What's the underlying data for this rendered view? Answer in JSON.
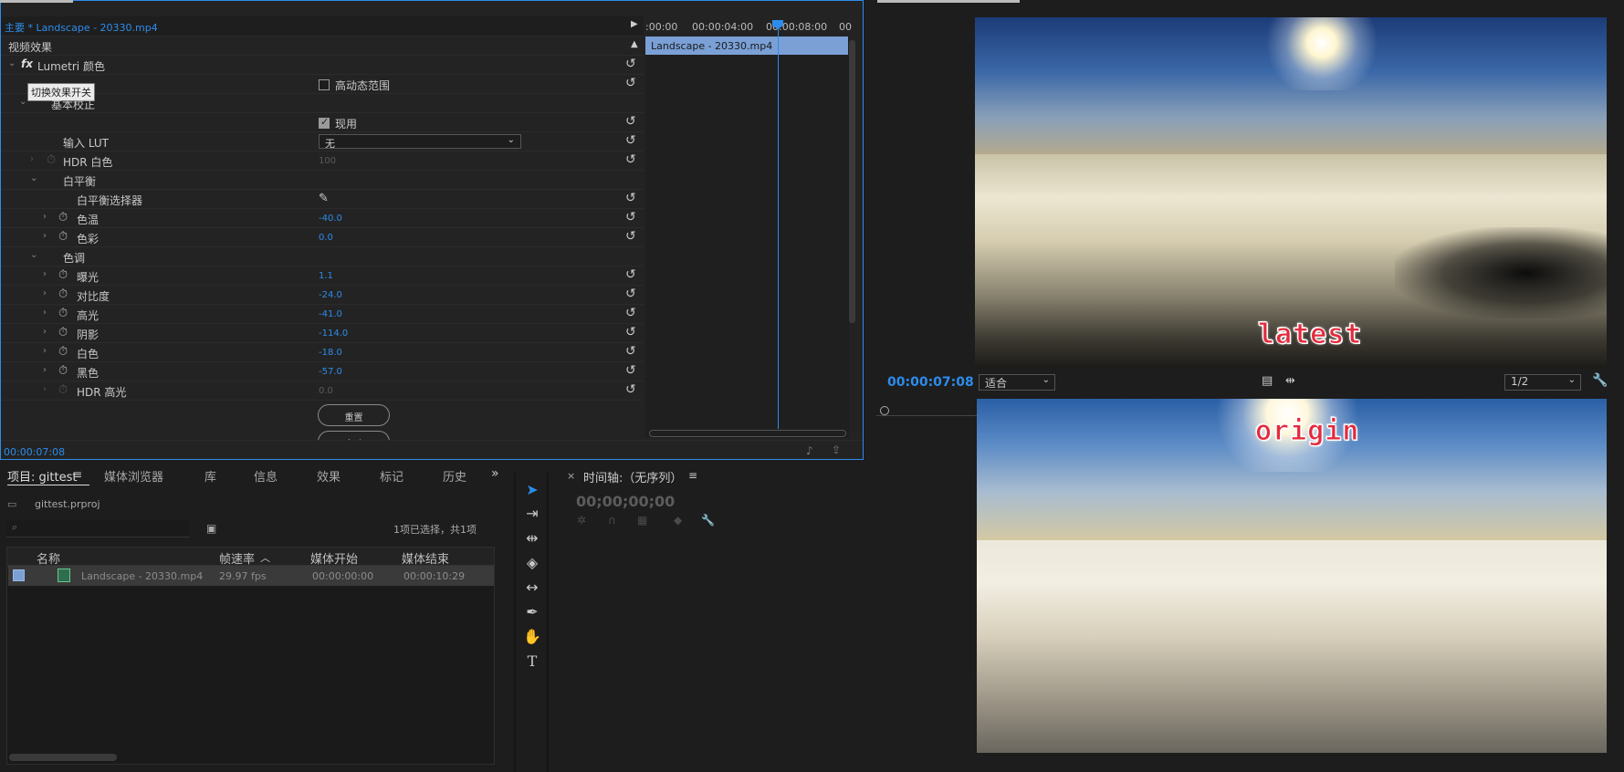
{
  "effect_controls": {
    "tab_title": "主要 * Landscape - 20330.mp4",
    "section": "视频效果",
    "fx_badge": "fx",
    "effect_name": "Lumetri 颜色",
    "tooltip": "切换效果开关",
    "hdr_range_label": "高动态范围",
    "basic_correction": "基本校正",
    "apply_label": "现用",
    "input_lut_label": "输入 LUT",
    "input_lut_value": "无",
    "hdr_white_label": "HDR 白色",
    "hdr_white_value": "100",
    "white_balance": "白平衡",
    "wb_picker": "白平衡选择器",
    "temperature_label": "色温",
    "temperature_value": "-40.0",
    "tint_label": "色彩",
    "tint_value": "0.0",
    "tone": "色调",
    "exposure_label": "曝光",
    "exposure_value": "1.1",
    "contrast_label": "对比度",
    "contrast_value": "-24.0",
    "highlights_label": "高光",
    "highlights_value": "-41.0",
    "shadows_label": "阴影",
    "shadows_value": "-114.0",
    "whites_label": "白色",
    "whites_value": "-18.0",
    "blacks_label": "黑色",
    "blacks_value": "-57.0",
    "hdr_spec_label": "HDR 高光",
    "hdr_spec_value": "0.0",
    "reset_button": "重置",
    "auto_button": "自动",
    "timecode": "00:00:07:08",
    "ruler_labels": [
      ":00:00",
      "00:00:04:00",
      "00:00:08:00",
      "00"
    ],
    "clip_name": "Landscape - 20330.mp4"
  },
  "program_monitor": {
    "latest_label": "latest",
    "origin_label": "origin",
    "timecode": "00:00:07:08",
    "fit_label": "适合",
    "resolution_label": "1/2"
  },
  "project": {
    "tabs": [
      "项目: gittest",
      "媒体浏览器",
      "库",
      "信息",
      "效果",
      "标记",
      "历史"
    ],
    "file_name": "gittest.prproj",
    "selection_info": "1项已选择，共1项",
    "columns": [
      "名称",
      "帧速率",
      "媒体开始",
      "媒体结束"
    ],
    "rows": [
      {
        "name": "Landscape - 20330.mp4",
        "fps": "29.97 fps",
        "start": "00:00:00:00",
        "end": "00:00:10:29"
      }
    ]
  },
  "timeline": {
    "title": "时间轴:（无序列）",
    "timecode": "00;00;00;00",
    "close": "×"
  },
  "colors": {
    "accent": "#2d8ceb",
    "overlay_text": "#e32b3d",
    "clip": "#7aa0d6"
  }
}
